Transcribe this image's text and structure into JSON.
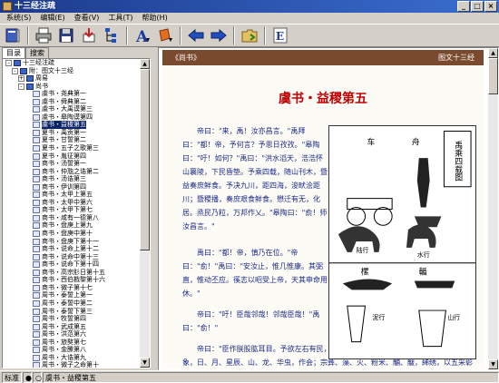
{
  "window": {
    "title": "十三经注疏"
  },
  "menu": [
    {
      "label": "系统(S)"
    },
    {
      "label": "编辑(E)"
    },
    {
      "label": "查看(V)"
    },
    {
      "label": "工具(T)"
    },
    {
      "label": "帮助(H)"
    }
  ],
  "toolbar": [
    {
      "icon": "book-icon"
    },
    {
      "icon": "printer-icon"
    },
    {
      "icon": "disk-icon"
    },
    {
      "icon": "download-icon"
    },
    {
      "icon": "tree-view-icon"
    },
    {
      "icon": "font-icon"
    },
    {
      "icon": "color-icon"
    },
    {
      "icon": "back-arrow-icon"
    },
    {
      "icon": "forward-arrow-icon"
    },
    {
      "icon": "folder-icon"
    },
    {
      "icon": "edit-icon",
      "text": "E"
    }
  ],
  "sidebar": {
    "tabs": [
      {
        "label": "目录"
      },
      {
        "label": "搜索"
      }
    ],
    "tree": [
      {
        "label": "十三经注疏",
        "level": 0,
        "kind": "book",
        "box": "-"
      },
      {
        "label": "附：图文十三经",
        "level": 1,
        "kind": "book",
        "box": "-"
      },
      {
        "label": "周易",
        "level": 2,
        "kind": "book",
        "box": "+"
      },
      {
        "label": "尚书",
        "level": 2,
        "kind": "book",
        "box": "-"
      },
      {
        "label": "虞书・尧典第一",
        "level": 3,
        "kind": "doc"
      },
      {
        "label": "虞书・舜典第二",
        "level": 3,
        "kind": "doc"
      },
      {
        "label": "虞书・大禹谟第三",
        "level": 3,
        "kind": "doc"
      },
      {
        "label": "虞书・皋陶谟第四",
        "level": 3,
        "kind": "doc"
      },
      {
        "label": "虞书・益稷第五",
        "level": 3,
        "kind": "doc",
        "selected": true
      },
      {
        "label": "夏书・禹贡第一",
        "level": 3,
        "kind": "doc"
      },
      {
        "label": "夏书・甘誓第二",
        "level": 3,
        "kind": "doc"
      },
      {
        "label": "夏书・五子之歌第三",
        "level": 3,
        "kind": "doc"
      },
      {
        "label": "夏书・胤征第四",
        "level": 3,
        "kind": "doc"
      },
      {
        "label": "商书・汤誓第一",
        "level": 3,
        "kind": "doc"
      },
      {
        "label": "商书・仲虺之诰第二",
        "level": 3,
        "kind": "doc"
      },
      {
        "label": "商书・汤诰第三",
        "level": 3,
        "kind": "doc"
      },
      {
        "label": "商书・伊训第四",
        "level": 3,
        "kind": "doc"
      },
      {
        "label": "商书・太甲上第五",
        "level": 3,
        "kind": "doc"
      },
      {
        "label": "商书・太甲中第六",
        "level": 3,
        "kind": "doc"
      },
      {
        "label": "商书・太甲下第七",
        "level": 3,
        "kind": "doc"
      },
      {
        "label": "商书・咸有一德第八",
        "level": 3,
        "kind": "doc"
      },
      {
        "label": "商书・盘庚上第九",
        "level": 3,
        "kind": "doc"
      },
      {
        "label": "商书・盘庚中第十",
        "level": 3,
        "kind": "doc"
      },
      {
        "label": "商书・盘庚下第十一",
        "level": 3,
        "kind": "doc"
      },
      {
        "label": "商书・说命上第十二",
        "level": 3,
        "kind": "doc"
      },
      {
        "label": "商书・说命中第十三",
        "level": 3,
        "kind": "doc"
      },
      {
        "label": "商书・说命下第十四",
        "level": 3,
        "kind": "doc"
      },
      {
        "label": "商书・高宗肜日第十五",
        "level": 3,
        "kind": "doc"
      },
      {
        "label": "商书・西伯戡黎第十六",
        "level": 3,
        "kind": "doc"
      },
      {
        "label": "商书・微子第十七",
        "level": 3,
        "kind": "doc"
      },
      {
        "label": "周书・泰誓上第一",
        "level": 3,
        "kind": "doc"
      },
      {
        "label": "周书・泰誓中第二",
        "level": 3,
        "kind": "doc"
      },
      {
        "label": "周书・泰誓下第三",
        "level": 3,
        "kind": "doc"
      },
      {
        "label": "周书・牧誓第四",
        "level": 3,
        "kind": "doc"
      },
      {
        "label": "周书・武成第五",
        "level": 3,
        "kind": "doc"
      },
      {
        "label": "周书・洪范第六",
        "level": 3,
        "kind": "doc"
      },
      {
        "label": "周书・旅獒第七",
        "level": 3,
        "kind": "doc"
      },
      {
        "label": "周书・金縢第八",
        "level": 3,
        "kind": "doc"
      },
      {
        "label": "周书・大诰第九",
        "level": 3,
        "kind": "doc"
      },
      {
        "label": "周书・微子之命第十",
        "level": 3,
        "kind": "doc"
      }
    ]
  },
  "viewer": {
    "source": "《尚书》",
    "label": "图文十三经",
    "chapter_title": "虞书・益稷第五",
    "paragraphs": [
      "　　帝曰：\"来，禹！汝亦昌言。\"禹拜曰：\"都！帝，予何言？予思日孜孜。\"皋陶曰：\"吁！如何？\"禹曰：\"洪水滔天，浩浩怀山襄陵，下民昏垫。予乘四载，随山刊木，暨益奏庶鲜食。予决九川，距四海，浚畎浍距川；暨稷播，奏庶艰食鲜食。懋迁有无，化居。烝民乃粒，万邦作乂。\"皋陶曰：\"俞！师汝昌言。\"",
      "　　禹曰：\"都！帝，慎乃在位。\"帝曰：\"俞！\"禹曰：\"安汝止，惟几惟康。其弼直，惟动丕应。徯志以昭受上帝，天其申命用休。\"",
      "　　帝曰：\"吁！臣哉邻哉！邻哉臣哉！\"禹曰：\"俞！\"",
      "　　帝曰：\"臣作朕股肱耳目。予欲左右有民，汝翼。予欲宣力四方，汝为。予欲观古人之象，日、月、星辰、山、龙、华虫，作会；宗彝、藻、火、粉米、黼、黻，絺绣，以五采彰施于五色，作服，汝"
    ],
    "illustration": {
      "title": "禹乘四载图",
      "labels": [
        "车",
        "舟",
        "陆行",
        "水行",
        "樏",
        "輴",
        "泥行",
        "山行"
      ]
    }
  },
  "status": {
    "mode": "标准",
    "location": "虞书・益稷第五"
  }
}
